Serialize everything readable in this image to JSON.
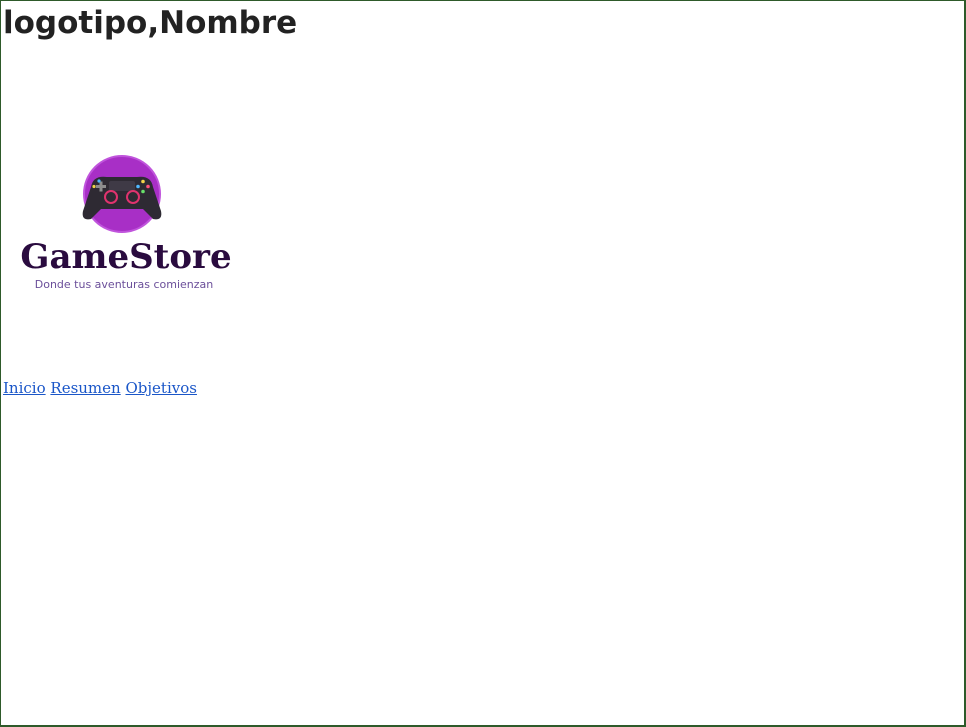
{
  "page": {
    "heading": "logotipo,Nombre"
  },
  "logo": {
    "brand": "GameStore",
    "tagline": "Donde tus aventuras comienzan",
    "icon": "gamepad-icon",
    "colors": {
      "circle": "#a82fc6",
      "controller": "#2e2a33",
      "brand_text": "#2a0b3f",
      "tagline_text": "#6b4f9a"
    }
  },
  "nav": {
    "links": [
      {
        "label": "Inicio"
      },
      {
        "label": "Resumen"
      },
      {
        "label": "Objetivos"
      }
    ],
    "link_color": "#1a56c8"
  }
}
